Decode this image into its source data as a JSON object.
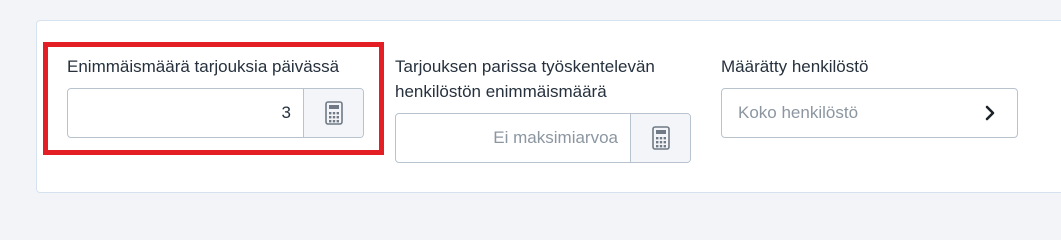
{
  "max_offers_per_day": {
    "label": "Enimmäismäärä tarjouksia päivässä",
    "value": "3",
    "calculator_icon": "calculator-icon"
  },
  "max_staff": {
    "label_line1": "Tarjouksen parissa työskentelevän",
    "label_line2": "henkilöstön enimmäismäärä",
    "placeholder": "Ei maksimiarvoa",
    "calculator_icon": "calculator-icon"
  },
  "assigned_staff": {
    "label": "Määrätty henkilöstö",
    "value": "Koko henkilöstö",
    "chevron_icon": "chevron-right-icon"
  },
  "colors": {
    "highlight": "#e31e24",
    "border": "#b9c3ce",
    "panel_border": "#d6e2f0"
  }
}
